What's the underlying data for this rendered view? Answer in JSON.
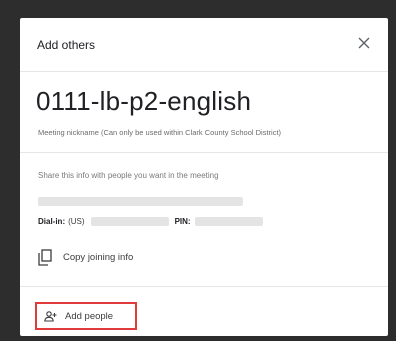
{
  "dialog": {
    "title": "Add others",
    "close_icon": "close-icon"
  },
  "meeting": {
    "name": "0111-lb-p2-english",
    "nickname_note": "Meeting nickname (Can only be used within Clark County School District)"
  },
  "share": {
    "info_text": "Share this info with people you want in the meeting",
    "dial_label": "Dial-in:",
    "dial_country": "(US)",
    "pin_label": "PIN:",
    "copy_label": "Copy joining info",
    "copy_icon": "copy-icon"
  },
  "add": {
    "label": "Add people",
    "icon": "add-person-icon",
    "highlight_color": "#e03a3a"
  }
}
